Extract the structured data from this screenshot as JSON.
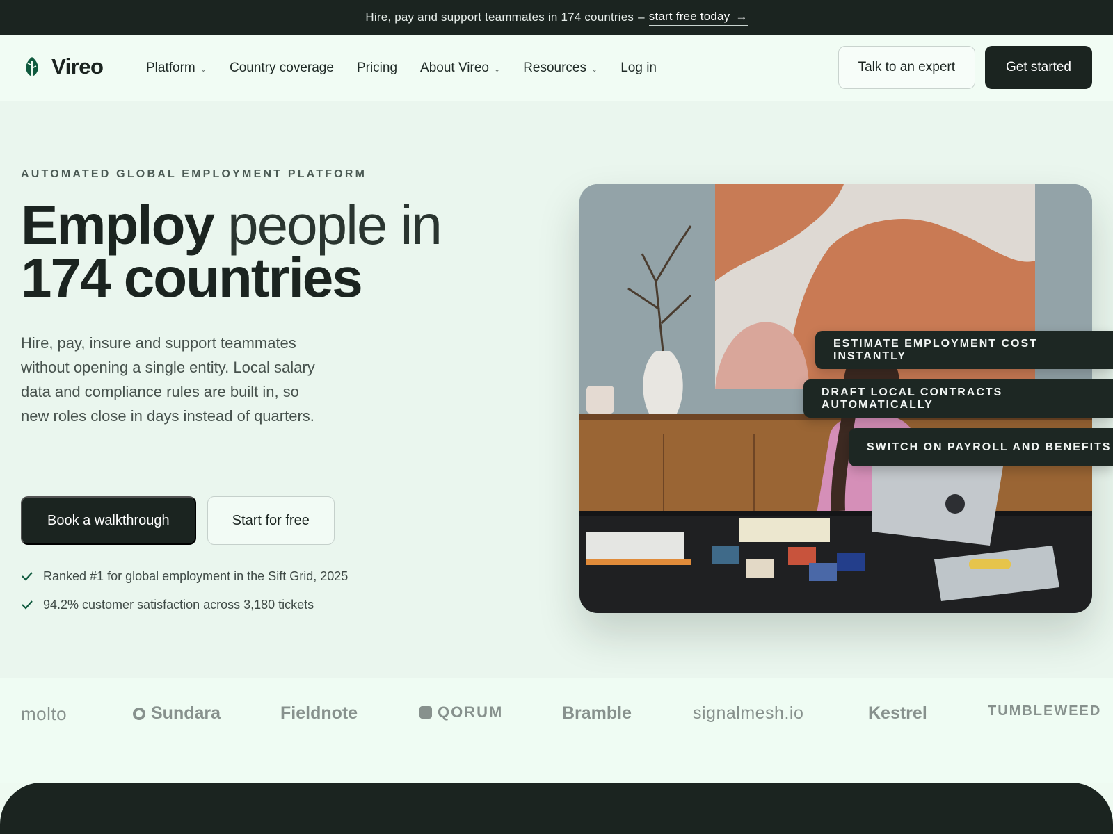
{
  "announcement": {
    "text": "Hire, pay and support teammates in 174 countries",
    "separator": "–",
    "link_text": "start free today",
    "arrow": "→"
  },
  "brand": {
    "name": "Vireo",
    "logo_icon": "leaf-icon",
    "accent": "#0f5a3e"
  },
  "nav": {
    "items": [
      {
        "label": "Platform",
        "has_menu": true
      },
      {
        "label": "Country coverage",
        "has_menu": false
      },
      {
        "label": "Pricing",
        "has_menu": false
      },
      {
        "label": "About Vireo",
        "has_menu": true
      },
      {
        "label": "Resources",
        "has_menu": true
      },
      {
        "label": "Log in",
        "has_menu": false
      }
    ],
    "expert_label": "Talk to an expert",
    "cta_label": "Get started"
  },
  "hero": {
    "eyebrow": "AUTOMATED GLOBAL EMPLOYMENT PLATFORM",
    "headline_bold_1": "Employ",
    "headline_light": " people in",
    "headline_bold_2": "174 countries",
    "lede": "Hire, pay, insure and support teammates without opening a single entity. Local salary data and compliance rules are built in, so new roles close in days instead of quarters.",
    "primary_cta": "Book a walkthrough",
    "secondary_cta": "Start for free",
    "proof": [
      "Ranked #1 for global employment in the Sift Grid, 2025",
      "94.2% customer satisfaction across 3,180 tickets"
    ],
    "features": [
      "ESTIMATE EMPLOYMENT COST INSTANTLY",
      "DRAFT LOCAL CONTRACTS AUTOMATICALLY",
      "SWITCH ON PAYROLL AND BENEFITS"
    ]
  },
  "logos": [
    "molto",
    "Sundara",
    "Fieldnote",
    "QORUM",
    "Bramble",
    "signalmesh.io",
    "Kestrel",
    "TUMBLEWEED"
  ],
  "colors": {
    "ink": "#1b2420",
    "background": "#eefaf1",
    "muted": "#87918d"
  }
}
